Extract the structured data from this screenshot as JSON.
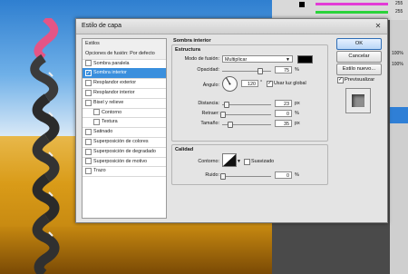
{
  "dialog": {
    "title": "Estilo de capa",
    "close": "✕"
  },
  "styles_list": [
    {
      "label": "Estilos",
      "type": "head"
    },
    {
      "label": "Opciones de fusión: Por defecto",
      "type": "head"
    },
    {
      "label": "Sombra paralela",
      "checked": false
    },
    {
      "label": "Sombra interior",
      "checked": true,
      "selected": true
    },
    {
      "label": "Resplandor exterior",
      "checked": false
    },
    {
      "label": "Resplandor interior",
      "checked": false
    },
    {
      "label": "Bisel y relieve",
      "checked": false
    },
    {
      "label": "Contorno",
      "checked": false,
      "indent": true
    },
    {
      "label": "Textura",
      "checked": false,
      "indent": true
    },
    {
      "label": "Satinado",
      "checked": false
    },
    {
      "label": "Superposición de colores",
      "checked": false
    },
    {
      "label": "Superposición de degradado",
      "checked": false
    },
    {
      "label": "Superposición de motivo",
      "checked": false
    },
    {
      "label": "Trazo",
      "checked": false
    }
  ],
  "inner_shadow": {
    "title": "Sombra interior",
    "structure": {
      "title": "Estructura",
      "blend_mode_label": "Modo de fusión:",
      "blend_mode": "Multiplicar",
      "color": "#000000",
      "opacity_label": "Opacidad:",
      "opacity": "75",
      "opacity_fraction": 0.75,
      "angle_label": "Ángulo:",
      "angle": "120",
      "angle_unit": "°",
      "global_light_label": "Usar luz global",
      "global_light": true,
      "distance_label": "Distancia:",
      "distance": "23",
      "distance_fraction": 0.08,
      "choke_label": "Retraer:",
      "choke": "0",
      "choke_fraction": 0.0,
      "size_label": "Tamaño:",
      "size": "35",
      "size_fraction": 0.14,
      "px": "px",
      "percent": "%"
    },
    "quality": {
      "title": "Calidad",
      "contour_label": "Contorno:",
      "antialias_label": "Suavizado",
      "antialias": false,
      "noise_label": "Ruido:",
      "noise": "0",
      "noise_fraction": 0.0,
      "percent": "%"
    }
  },
  "buttons": {
    "ok": "OK",
    "cancel": "Cancelar",
    "new_style": "Estilo nuevo...",
    "preview_label": "Previsualizar",
    "preview": true
  },
  "right_panel": {
    "values": [
      "255",
      "255",
      "100%",
      "100%"
    ]
  }
}
